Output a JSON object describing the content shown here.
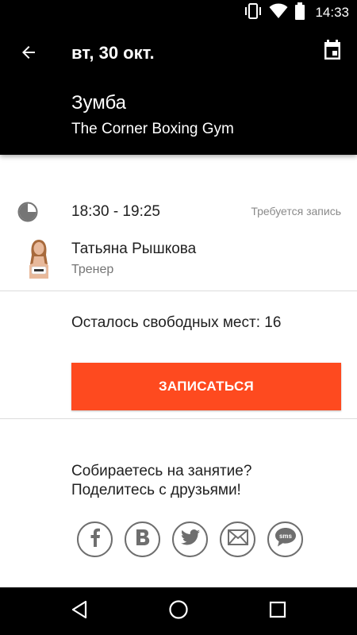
{
  "status_bar": {
    "time": "14:33",
    "icons": [
      "vibrate-icon",
      "wifi-icon",
      "battery-icon"
    ]
  },
  "header": {
    "date": "вт, 30 окт.",
    "class_name": "Зумба",
    "gym_name": "The Corner Boxing Gym",
    "icons": [
      "back-arrow-icon",
      "calendar-icon"
    ]
  },
  "session": {
    "time": "18:30 - 19:25",
    "signup_note": "Требуется запись",
    "trainer_name": "Татьяна Рышкова",
    "trainer_role": "Тренер"
  },
  "availability": {
    "seats_text": "Осталось свободных мест: 16"
  },
  "actions": {
    "signup_label": "ЗАПИСАТЬСЯ"
  },
  "share": {
    "line1": "Собираетесь на занятие?",
    "line2": "Поделитесь с друзьями!",
    "sms_label": "sms",
    "buttons": [
      "facebook-icon",
      "vk-icon",
      "twitter-icon",
      "email-icon",
      "sms-icon"
    ]
  },
  "colors": {
    "accent": "#fe4a1f",
    "header_bg": "#000000",
    "icon_gray": "#6e6e6e"
  }
}
